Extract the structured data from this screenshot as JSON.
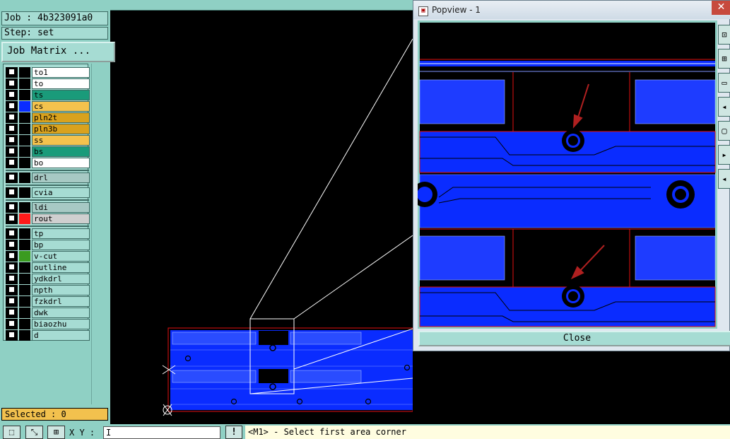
{
  "job": {
    "label": "Job : 4b323091a0",
    "step": "Step: set",
    "matrix_button": "Job Matrix ..."
  },
  "layers": [
    {
      "name": "to1",
      "color": "#ffffff",
      "swatch": "#000000"
    },
    {
      "name": "to",
      "color": "#ffffff",
      "swatch": "#000000"
    },
    {
      "name": "ts",
      "color": "#1a9b7a",
      "swatch": "#000000"
    },
    {
      "name": "cs",
      "color": "#f4c24d",
      "swatch": "#0a2cff"
    },
    {
      "name": "pln2t",
      "color": "#d9a21e",
      "swatch": "#000000"
    },
    {
      "name": "pln3b",
      "color": "#d9a21e",
      "swatch": "#000000"
    },
    {
      "name": "ss",
      "color": "#f4c24d",
      "swatch": "#000000"
    },
    {
      "name": "bs",
      "color": "#1a9b7a",
      "swatch": "#000000"
    },
    {
      "name": "bo",
      "color": "#ffffff",
      "swatch": "#000000"
    },
    {
      "name": "drl",
      "color": "#a7c9c4",
      "swatch": "#000000"
    },
    {
      "name": "cvia",
      "color": "#a6dcd3",
      "swatch": "#000000"
    },
    {
      "name": "ldi",
      "color": "#a7c9c4",
      "swatch": "#000000"
    },
    {
      "name": "rout",
      "color": "#cfcfcf",
      "swatch": "#ff1a1a"
    },
    {
      "name": "tp",
      "color": "#a6dcd3",
      "swatch": "#000000"
    },
    {
      "name": "bp",
      "color": "#a6dcd3",
      "swatch": "#000000"
    },
    {
      "name": "v-cut",
      "color": "#a6dcd3",
      "swatch": "#3b9b20"
    },
    {
      "name": "outline",
      "color": "#a6dcd3",
      "swatch": "#000000"
    },
    {
      "name": "ydkdrl",
      "color": "#a6dcd3",
      "swatch": "#000000"
    },
    {
      "name": "npth",
      "color": "#a6dcd3",
      "swatch": "#000000"
    },
    {
      "name": "fzkdrl",
      "color": "#a6dcd3",
      "swatch": "#000000"
    },
    {
      "name": "dwk",
      "color": "#a6dcd3",
      "swatch": "#000000"
    },
    {
      "name": "biaozhu",
      "color": "#a6dcd3",
      "swatch": "#000000"
    },
    {
      "name": "d",
      "color": "#a6dcd3",
      "swatch": "#000000"
    }
  ],
  "selected": "Selected : 0",
  "popview": {
    "title": "Popview - 1",
    "close_button": "Close",
    "close_x": "✕"
  },
  "bottom": {
    "xy_label": "X Y :",
    "xy_value": "I",
    "status": "<M1> - Select first area corner",
    "excl": "!"
  },
  "colors": {
    "panel": "#8fd0c4",
    "board_copper": "#0a2cff",
    "outline_red": "#e01010"
  }
}
